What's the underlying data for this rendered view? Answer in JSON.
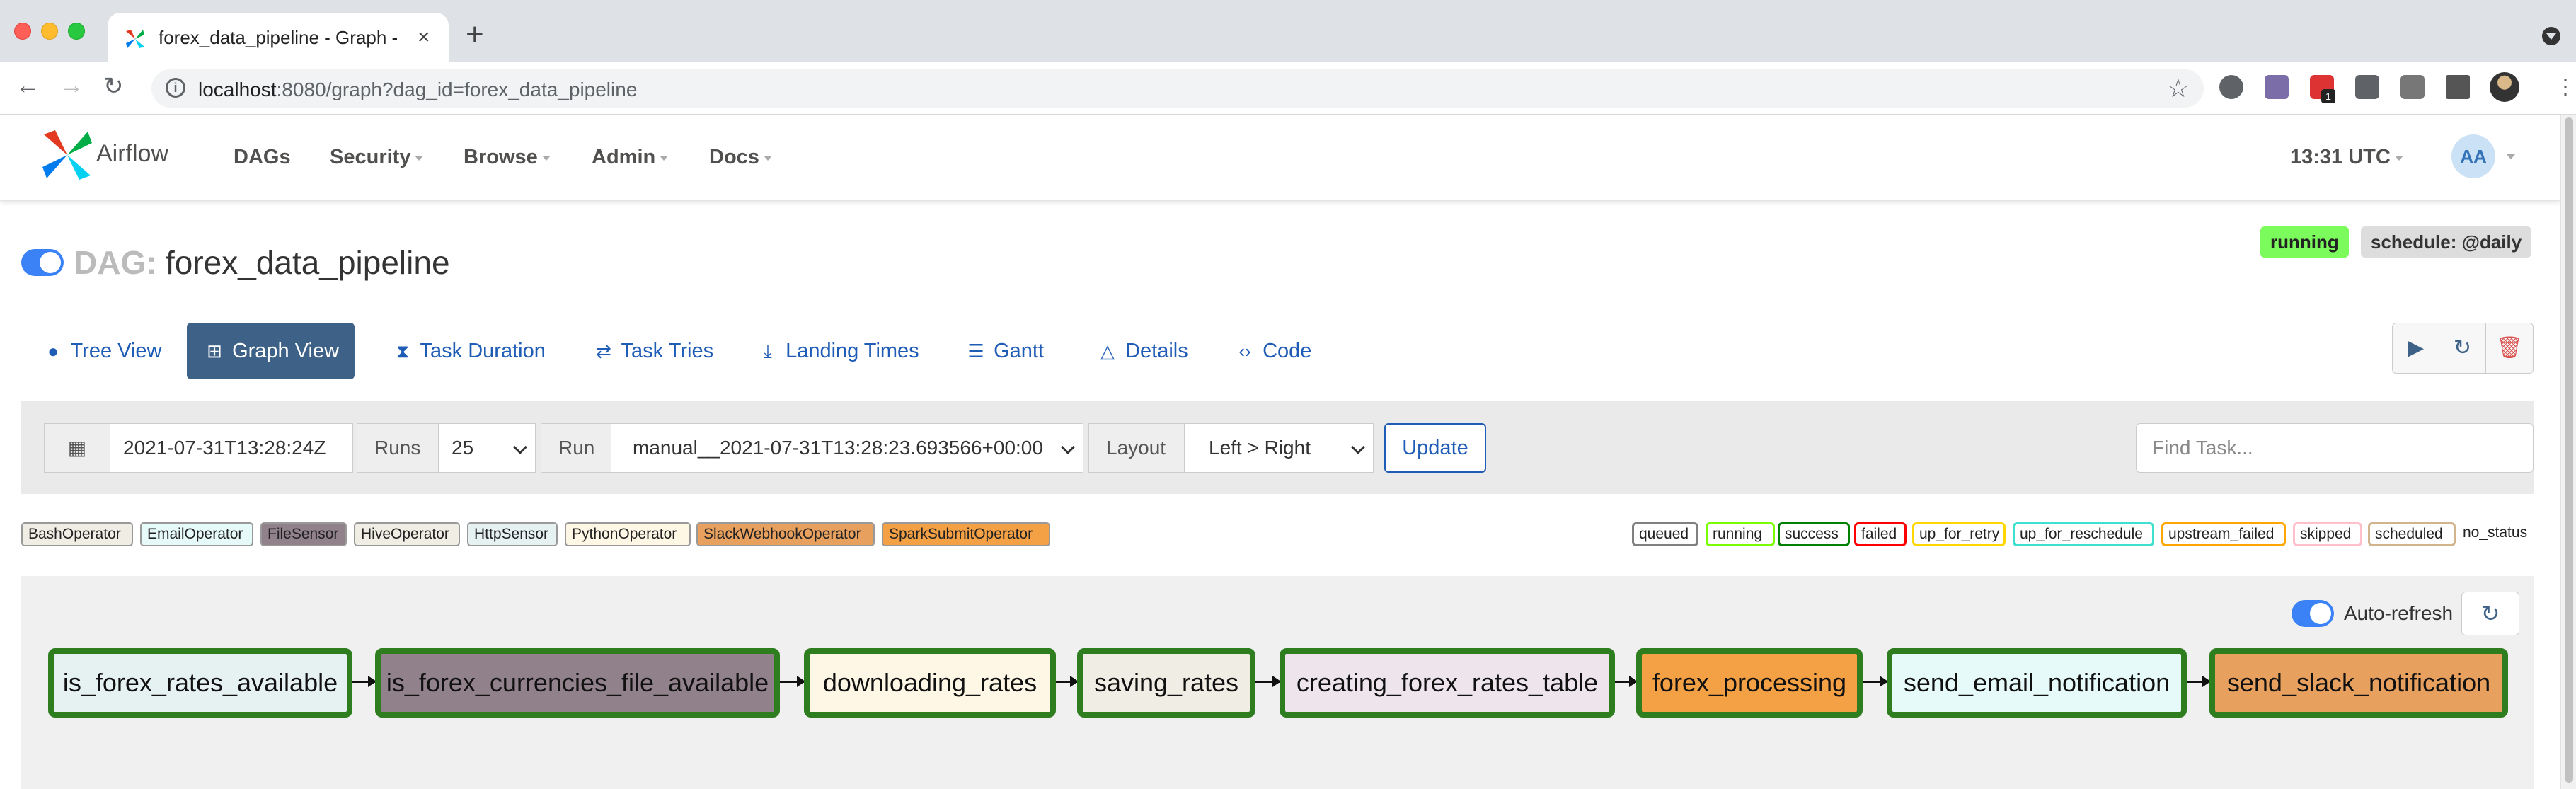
{
  "browser": {
    "tab_title": "forex_data_pipeline - Graph - A",
    "url_host": "localhost",
    "url_rest": ":8080/graph?dag_id=forex_data_pipeline",
    "ext_badge": "1"
  },
  "nav": {
    "brand": "Airflow",
    "menu": [
      "DAGs",
      "Security",
      "Browse",
      "Admin",
      "Docs"
    ],
    "time": "13:31 UTC",
    "avatar": "AA"
  },
  "dag": {
    "label": "DAG:",
    "id": "forex_data_pipeline",
    "status": "running",
    "schedule": "schedule: @daily"
  },
  "view_tabs": [
    "Tree View",
    "Graph View",
    "Task Duration",
    "Task Tries",
    "Landing Times",
    "Gantt",
    "Details",
    "Code"
  ],
  "filters": {
    "date": "2021-07-31T13:28:24Z",
    "runs_label": "Runs",
    "runs_value": "25",
    "run_label": "Run",
    "run_value": "manual__2021-07-31T13:28:23.693566+00:00",
    "layout_label": "Layout",
    "layout_value": "Left > Right",
    "update": "Update",
    "find_placeholder": "Find Task..."
  },
  "operators": [
    {
      "name": "BashOperator",
      "color": "#f0ede4"
    },
    {
      "name": "EmailOperator",
      "color": "#e6faf9"
    },
    {
      "name": "FileSensor",
      "color": "#91818a"
    },
    {
      "name": "HiveOperator",
      "color": "#f0ede4"
    },
    {
      "name": "HttpSensor",
      "color": "#e6f1f2"
    },
    {
      "name": "PythonOperator",
      "color": "#fff7e6"
    },
    {
      "name": "SlackWebhookOperator",
      "color": "#e8a05f"
    },
    {
      "name": "SparkSubmitOperator",
      "color": "#f4a044"
    }
  ],
  "states": [
    {
      "name": "queued",
      "color": "#808080"
    },
    {
      "name": "running",
      "color": "#7cfc00"
    },
    {
      "name": "success",
      "color": "#008000"
    },
    {
      "name": "failed",
      "color": "#ff0000"
    },
    {
      "name": "up_for_retry",
      "color": "#ffd700"
    },
    {
      "name": "up_for_reschedule",
      "color": "#40e0d0"
    },
    {
      "name": "upstream_failed",
      "color": "#ffa500"
    },
    {
      "name": "skipped",
      "color": "#ffc0cb"
    },
    {
      "name": "scheduled",
      "color": "#d2b48c"
    }
  ],
  "no_status": "no_status",
  "graph": {
    "auto_refresh": "Auto-refresh",
    "tasks": [
      {
        "name": "is_forex_rates_available",
        "color": "#e6f1f2"
      },
      {
        "name": "is_forex_currencies_file_available",
        "color": "#91818a"
      },
      {
        "name": "downloading_rates",
        "color": "#fff7e6"
      },
      {
        "name": "saving_rates",
        "color": "#f0ede4"
      },
      {
        "name": "creating_forex_rates_table",
        "color": "#ede4ec"
      },
      {
        "name": "forex_processing",
        "color": "#f4a044"
      },
      {
        "name": "send_email_notification",
        "color": "#e6faf9"
      },
      {
        "name": "send_slack_notification",
        "color": "#e8a05f"
      }
    ]
  }
}
